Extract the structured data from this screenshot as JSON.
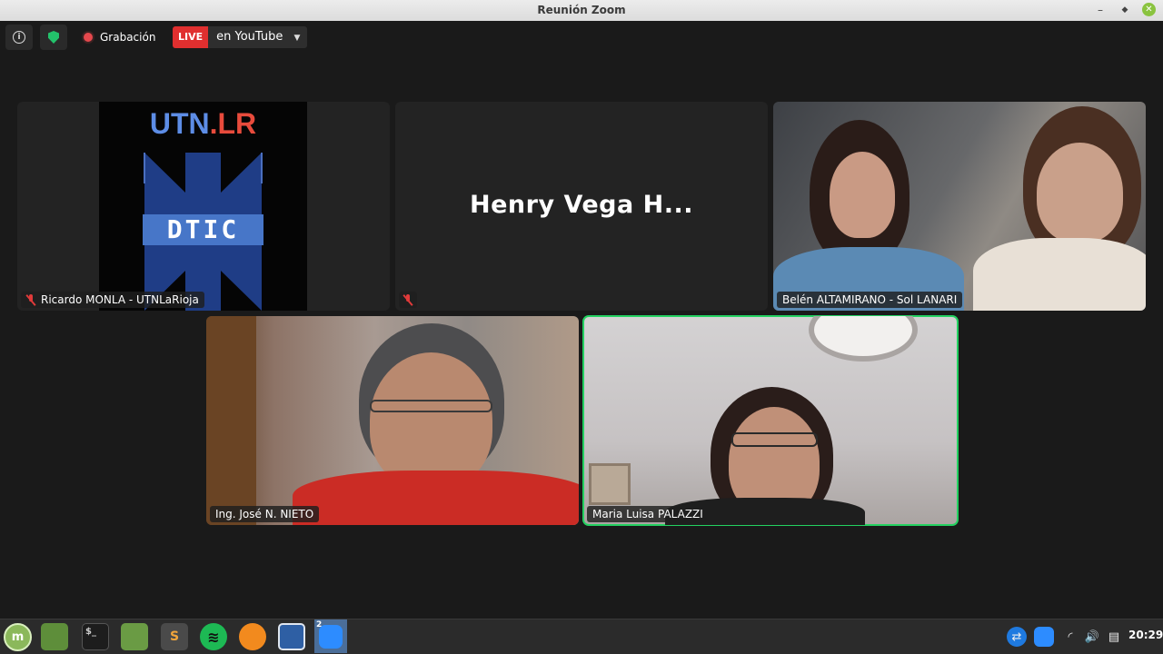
{
  "window": {
    "title": "Reunión Zoom"
  },
  "toolbar": {
    "recording_label": "Grabación",
    "live_badge": "LIVE",
    "stream_label": "en YouTube"
  },
  "tiles": [
    {
      "name": "Ricardo MONLA - UTNLaRioja",
      "muted": true,
      "logo_text_a": "UTN",
      "logo_text_b": ".LR",
      "logo_badge": "DTIC"
    },
    {
      "display_name": "Henry Vega H...",
      "muted": true
    },
    {
      "name": "Belén ALTAMIRANO - Sol LANARI",
      "muted": false
    },
    {
      "name": "Ing. José N. NIETO",
      "muted": false
    },
    {
      "name": "Maria Luisa PALAZZI",
      "muted": false,
      "active_speaker": true
    }
  ],
  "taskbar": {
    "apps": [
      "mint-menu",
      "file-manager",
      "terminal",
      "files",
      "sublime-text",
      "spotify",
      "firefox",
      "screenshot",
      "zoom"
    ],
    "zoom_badge": "2",
    "clock": "20:29"
  },
  "colors": {
    "active_border": "#23d160",
    "live_red": "#e02f2f",
    "mute_red": "#e03a3a",
    "background": "#1a1a1a"
  }
}
